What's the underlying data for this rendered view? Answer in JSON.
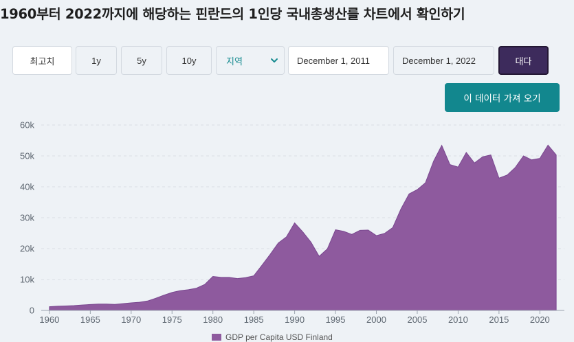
{
  "page": {
    "title": "1960부터 2022까지에 해당하는 핀란드의 1인당 국내총생산를 차트에서 확인하기"
  },
  "controls": {
    "max_label": "최고치",
    "range_1y": "1y",
    "range_5y": "5y",
    "range_10y": "10y",
    "region_label": "지역",
    "start_date": "December 1, 2011",
    "end_date": "December 1, 2022",
    "go_label": "대다",
    "fetch_label": "이 데이터 가져 오기"
  },
  "colors": {
    "area_fill": "#8e5a9e",
    "area_stroke": "#7a4890",
    "accent_teal": "#12878e",
    "button_dark": "#3d2b5c"
  },
  "chart_data": {
    "type": "area",
    "title": "",
    "xlabel": "",
    "ylabel": "",
    "xlim": [
      1959,
      2023
    ],
    "ylim": [
      0,
      60000
    ],
    "y_ticks": [
      0,
      10000,
      20000,
      30000,
      40000,
      50000,
      60000
    ],
    "y_tick_labels": [
      "0",
      "10k",
      "20k",
      "30k",
      "40k",
      "50k",
      "60k"
    ],
    "x_ticks": [
      1960,
      1965,
      1970,
      1975,
      1980,
      1985,
      1990,
      1995,
      2000,
      2005,
      2010,
      2015,
      2020
    ],
    "grid": true,
    "legend": "bottom",
    "legend_visible_text": "GDP per Capita USD Finland",
    "series": [
      {
        "name": "GDP per Capita USD Finland",
        "x": [
          1960,
          1961,
          1962,
          1963,
          1964,
          1965,
          1966,
          1967,
          1968,
          1969,
          1970,
          1971,
          1972,
          1973,
          1974,
          1975,
          1976,
          1977,
          1978,
          1979,
          1980,
          1981,
          1982,
          1983,
          1984,
          1985,
          1986,
          1987,
          1988,
          1989,
          1990,
          1991,
          1992,
          1993,
          1994,
          1995,
          1996,
          1997,
          1998,
          1999,
          2000,
          2001,
          2002,
          2003,
          2004,
          2005,
          2006,
          2007,
          2008,
          2009,
          2010,
          2011,
          2012,
          2013,
          2014,
          2015,
          2016,
          2017,
          2018,
          2019,
          2020,
          2021,
          2022
        ],
        "values": [
          1200,
          1350,
          1450,
          1550,
          1750,
          1900,
          2050,
          2050,
          1950,
          2200,
          2450,
          2650,
          3050,
          3900,
          4900,
          5800,
          6400,
          6700,
          7200,
          8400,
          11000,
          10700,
          10700,
          10300,
          10600,
          11200,
          14600,
          18100,
          21800,
          23800,
          28300,
          25400,
          22100,
          17500,
          19900,
          26100,
          25600,
          24600,
          25900,
          26000,
          24200,
          24900,
          26800,
          32800,
          37700,
          39100,
          41300,
          48300,
          53400,
          47200,
          46400,
          51100,
          47700,
          49700,
          50300,
          42800,
          43800,
          46300,
          50000,
          48700,
          49200,
          53500,
          50300
        ]
      }
    ]
  }
}
